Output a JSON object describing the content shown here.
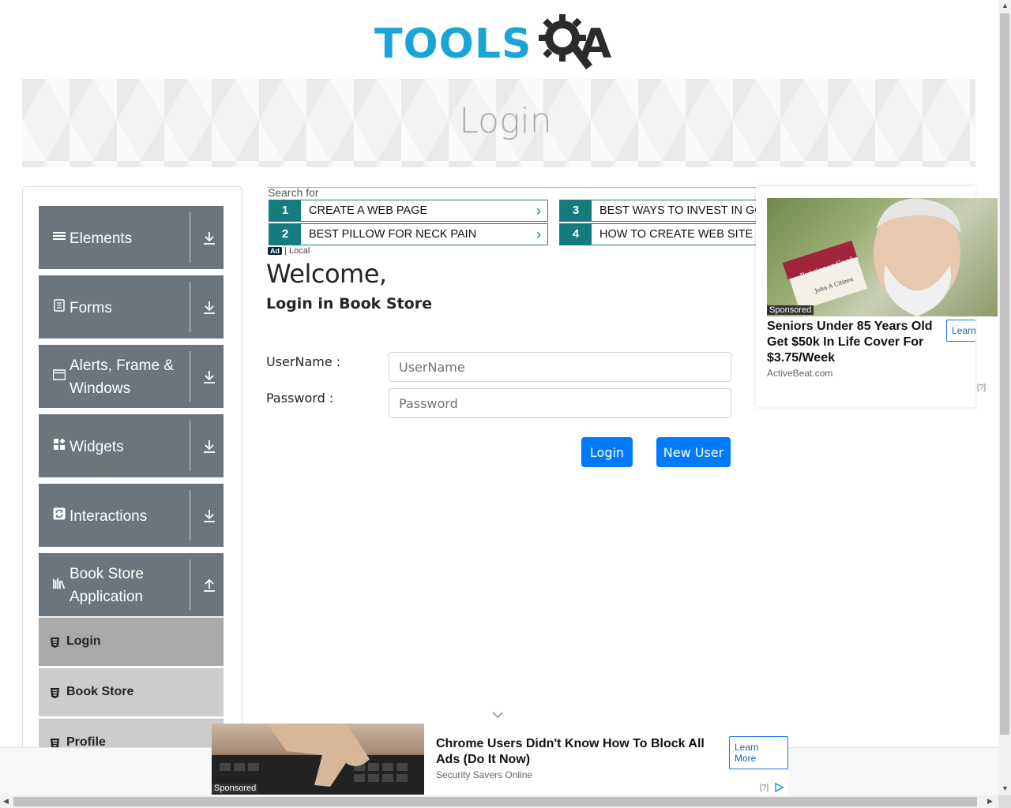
{
  "header": {
    "logo_text": "TOOLS",
    "logo_suffix": "A",
    "logo_q_icon": "magnifier-gear-icon",
    "brand_color": "#1aa5d8"
  },
  "banner": {
    "title": "Login"
  },
  "sidebar": {
    "groups": [
      {
        "label": "Elements",
        "icon": "hamburger-icon",
        "arrow": "download-icon"
      },
      {
        "label": "Forms",
        "icon": "document-icon",
        "arrow": "download-icon"
      },
      {
        "label": "Alerts, Frame & Windows",
        "icon": "window-icon",
        "arrow": "download-icon"
      },
      {
        "label": "Widgets",
        "icon": "widgets-icon",
        "arrow": "download-icon"
      },
      {
        "label": "Interactions",
        "icon": "refresh-icon",
        "arrow": "download-icon"
      },
      {
        "label": "Book Store Application",
        "icon": "books-icon",
        "arrow": "upload-icon"
      }
    ],
    "book_store_items": [
      {
        "label": "Login",
        "active": true
      },
      {
        "label": "Book Store",
        "active": false
      },
      {
        "label": "Profile",
        "active": false
      }
    ],
    "group_color": "#6c757d"
  },
  "search_ads": {
    "heading": "Search for",
    "items": [
      {
        "num": "1",
        "text": "CREATE A WEB PAGE"
      },
      {
        "num": "2",
        "text": "BEST PILLOW FOR NECK PAIN"
      },
      {
        "num": "3",
        "text": "BEST WAYS TO INVEST IN GOLD"
      },
      {
        "num": "4",
        "text": "HOW TO CREATE WEB SITE"
      }
    ],
    "ad_badge": "Ad",
    "ad_local": "| Local",
    "accent": "#147b7e"
  },
  "main": {
    "welcome": "Welcome,",
    "subtitle": "Login in Book Store",
    "username_label": "UserName :",
    "username_placeholder": "UserName",
    "password_label": "Password :",
    "password_placeholder": "Password",
    "login_button": "Login",
    "new_user_button": "New User",
    "button_color": "#007bff"
  },
  "side_ad": {
    "card_title": "Pensioner Card",
    "card_name": "John A Citizen",
    "sponsored": "Sponsored",
    "title": "Seniors Under 85 Years Old Get $50k In Life Cover For $3.75/Week",
    "source": "ActiveBeat.com",
    "learn_more": "Learn More",
    "help": "[?]"
  },
  "bottom_ad": {
    "sponsored": "Sponsored",
    "title": "Chrome Users Didn't Know How To Block All Ads (Do It Now)",
    "source": "Security Savers Online",
    "learn_more": "Learn More",
    "help": "[?]"
  },
  "scrollbars": {
    "up": "▲",
    "down": "▼",
    "left": "◀",
    "right": "▶"
  }
}
